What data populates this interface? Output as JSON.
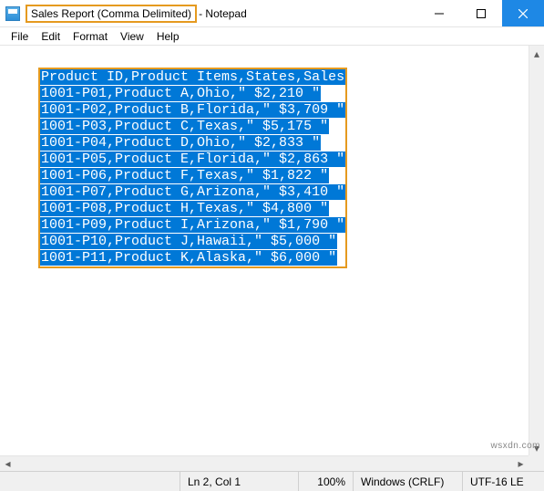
{
  "window": {
    "filename": "Sales Report (Comma Delimited)",
    "separator": " - ",
    "app": "Notepad"
  },
  "menu": {
    "file": "File",
    "edit": "Edit",
    "format": "Format",
    "view": "View",
    "help": "Help"
  },
  "content": {
    "header": "Product ID,Product Items,States,Sales",
    "lines": [
      "1001-P01,Product A,Ohio,\" $2,210 \"",
      "1001-P02,Product B,Florida,\" $3,709 \"",
      "1001-P03,Product C,Texas,\" $5,175 \"",
      "1001-P04,Product D,Ohio,\" $2,833 \"",
      "1001-P05,Product E,Florida,\" $2,863 \"",
      "1001-P06,Product F,Texas,\" $1,822 \"",
      "1001-P07,Product G,Arizona,\" $3,410 \"",
      "1001-P08,Product H,Texas,\" $4,800 \"",
      "1001-P09,Product I,Arizona,\" $1,790 \"",
      "1001-P10,Product J,Hawaii,\" $5,000 \"",
      "1001-P11,Product K,Alaska,\" $6,000 \""
    ]
  },
  "status": {
    "position": "Ln 2, Col 1",
    "zoom": "100%",
    "eol": "Windows (CRLF)",
    "encoding": "UTF-16 LE"
  },
  "watermark": "wsxdn.com"
}
